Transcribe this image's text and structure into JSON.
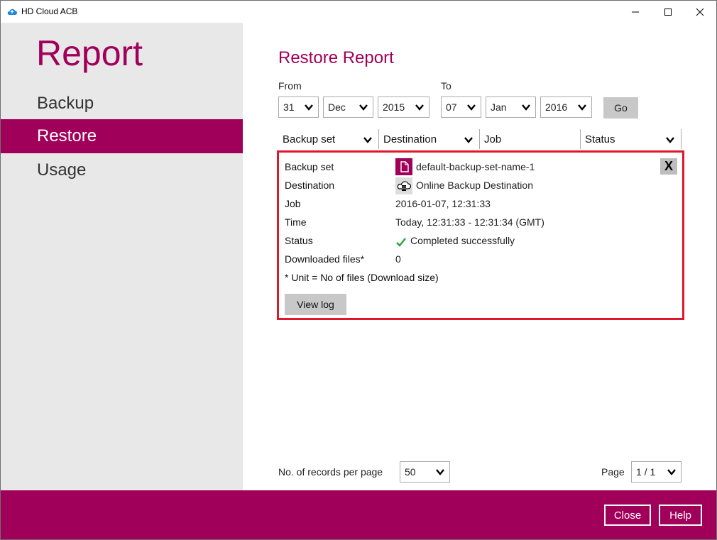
{
  "window": {
    "app_title": "HD Cloud ACB"
  },
  "sidebar": {
    "title": "Report",
    "items": [
      {
        "label": "Backup",
        "active": false
      },
      {
        "label": "Restore",
        "active": true
      },
      {
        "label": "Usage",
        "active": false
      }
    ]
  },
  "main": {
    "title": "Restore Report",
    "from_label": "From",
    "to_label": "To",
    "from": {
      "day": "31",
      "month": "Dec",
      "year": "2015"
    },
    "to": {
      "day": "07",
      "month": "Jan",
      "year": "2016"
    },
    "go_label": "Go",
    "columns": [
      "Backup set",
      "Destination",
      "Job",
      "Status"
    ],
    "detail": {
      "rows": [
        {
          "label": "Backup set",
          "value": "default-backup-set-name-1"
        },
        {
          "label": "Destination",
          "value": "Online Backup Destination"
        },
        {
          "label": "Job",
          "value": "2016-01-07, 12:31:33"
        },
        {
          "label": "Time",
          "value": "Today, 12:31:33 - 12:31:34 (GMT)"
        },
        {
          "label": "Status",
          "value": "Completed successfully"
        },
        {
          "label": "Downloaded files*",
          "value": "0"
        }
      ],
      "unit_note": "* Unit = No of files (Download size)",
      "view_log_label": "View log",
      "close_label": "X"
    },
    "records_label": "No. of records per page",
    "records_value": "50",
    "page_label": "Page",
    "page_value": "1 / 1"
  },
  "footer": {
    "close_label": "Close",
    "help_label": "Help"
  },
  "colors": {
    "accent": "#a1005a",
    "highlight_border": "#e0162b",
    "success": "#2e9e3e"
  }
}
